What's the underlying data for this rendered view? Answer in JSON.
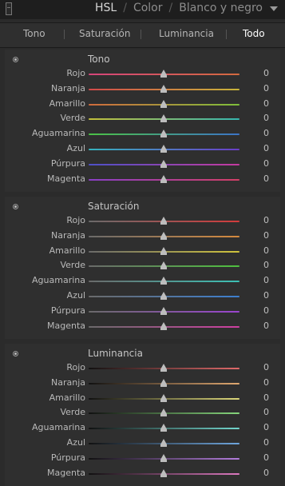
{
  "header": {
    "titles": [
      "HSL",
      "Color",
      "Blanco y negro"
    ],
    "separator": "/"
  },
  "tabs": [
    "Tono",
    "Saturación",
    "Luminancia",
    "Todo"
  ],
  "active_tab": "Todo",
  "sections": [
    {
      "title": "Tono",
      "rows": [
        {
          "label": "Rojo",
          "value": "0",
          "gradient": [
            "#d5457a",
            "#d46a3f"
          ]
        },
        {
          "label": "Naranja",
          "value": "0",
          "gradient": [
            "#d34a4a",
            "#c8b43a"
          ]
        },
        {
          "label": "Amarillo",
          "value": "0",
          "gradient": [
            "#d06b3c",
            "#7fbf3a"
          ]
        },
        {
          "label": "Verde",
          "value": "0",
          "gradient": [
            "#c3bf3a",
            "#36b7b0"
          ]
        },
        {
          "label": "Aguamarina",
          "value": "0",
          "gradient": [
            "#4bc245",
            "#3c74c7"
          ]
        },
        {
          "label": "Azul",
          "value": "0",
          "gradient": [
            "#35b3bd",
            "#6a3ec7"
          ]
        },
        {
          "label": "Púrpura",
          "value": "0",
          "gradient": [
            "#4d50c8",
            "#c63a9f"
          ]
        },
        {
          "label": "Magenta",
          "value": "0",
          "gradient": [
            "#8a3fc7",
            "#d33f66"
          ]
        }
      ]
    },
    {
      "title": "Saturación",
      "rows": [
        {
          "label": "Rojo",
          "value": "0",
          "gradient": [
            "#6a6a6a",
            "#d33c3c"
          ]
        },
        {
          "label": "Naranja",
          "value": "0",
          "gradient": [
            "#6a6a6a",
            "#d58a3e"
          ]
        },
        {
          "label": "Amarillo",
          "value": "0",
          "gradient": [
            "#6a6a6a",
            "#cfc33c"
          ]
        },
        {
          "label": "Verde",
          "value": "0",
          "gradient": [
            "#6a6a6a",
            "#4fc13f"
          ]
        },
        {
          "label": "Aguamarina",
          "value": "0",
          "gradient": [
            "#6a6a6a",
            "#3cc1b5"
          ]
        },
        {
          "label": "Azul",
          "value": "0",
          "gradient": [
            "#6a6a6a",
            "#3d7fcf"
          ]
        },
        {
          "label": "Púrpura",
          "value": "0",
          "gradient": [
            "#6a6a6a",
            "#9a45cf"
          ]
        },
        {
          "label": "Magenta",
          "value": "0",
          "gradient": [
            "#6a6a6a",
            "#cf3fa2"
          ]
        }
      ]
    },
    {
      "title": "Luminancia",
      "rows": [
        {
          "label": "Rojo",
          "value": "0",
          "gradient": [
            "#111111",
            "#e06a6a"
          ]
        },
        {
          "label": "Naranja",
          "value": "0",
          "gradient": [
            "#111111",
            "#e0a870"
          ]
        },
        {
          "label": "Amarillo",
          "value": "0",
          "gradient": [
            "#111111",
            "#dcd77a"
          ]
        },
        {
          "label": "Verde",
          "value": "0",
          "gradient": [
            "#111111",
            "#86d67c"
          ]
        },
        {
          "label": "Aguamarina",
          "value": "0",
          "gradient": [
            "#111111",
            "#72d6cd"
          ]
        },
        {
          "label": "Azul",
          "value": "0",
          "gradient": [
            "#111111",
            "#6fa6dd"
          ]
        },
        {
          "label": "Púrpura",
          "value": "0",
          "gradient": [
            "#111111",
            "#b37ddc"
          ]
        },
        {
          "label": "Magenta",
          "value": "0",
          "gradient": [
            "#111111",
            "#dc78bf"
          ]
        }
      ]
    }
  ]
}
